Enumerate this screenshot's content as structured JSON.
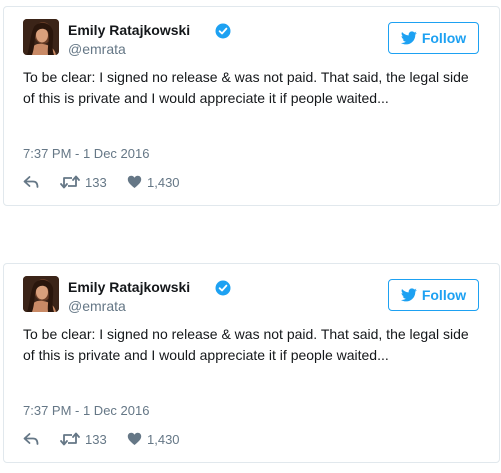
{
  "tweets": [
    {
      "author_name": "Emily Ratajkowski",
      "handle": "@emrata",
      "follow_label": "Follow",
      "text": "To be clear: I signed no release & was not paid. That said, the legal side of this is private and I would appreciate it if people waited...",
      "timestamp": "7:37 PM - 1 Dec 2016",
      "retweets": "133",
      "likes": "1,430"
    },
    {
      "author_name": "Emily Ratajkowski",
      "handle": "@emrata",
      "follow_label": "Follow",
      "text": "To be clear: I signed no release & was not paid. That said, the legal side of this is private and I would appreciate it if people waited...",
      "timestamp": "7:37 PM - 1 Dec 2016",
      "retweets": "133",
      "likes": "1,430"
    }
  ],
  "icons": {
    "verified": "verified-badge-icon",
    "follow": "twitter-bird-icon",
    "reply": "reply-arrow-icon",
    "retweet": "retweet-icon",
    "like": "heart-icon"
  },
  "colors": {
    "accent": "#1da1f2",
    "text": "#14171a",
    "muted": "#657786",
    "border": "#e1e8ed"
  }
}
